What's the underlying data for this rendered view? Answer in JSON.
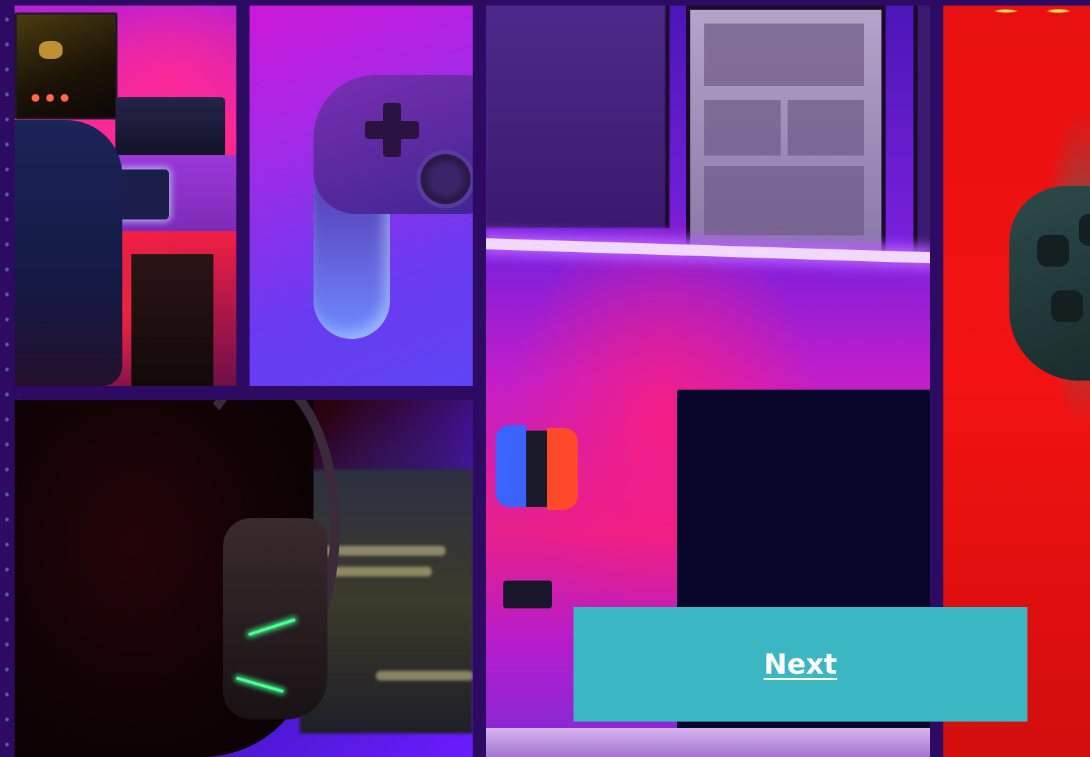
{
  "colors": {
    "background": "#2d0b63",
    "button": "#3bb6c3",
    "button_text": "#ffffff"
  },
  "gallery": {
    "tiles": [
      {
        "subject": "gamer-desk-photo"
      },
      {
        "subject": "controller-photo"
      },
      {
        "subject": "headset-gamer-photo"
      },
      {
        "subject": "led-wall-photo"
      },
      {
        "subject": "red-controller-photo"
      }
    ]
  },
  "navigation": {
    "next_label": "Next"
  }
}
